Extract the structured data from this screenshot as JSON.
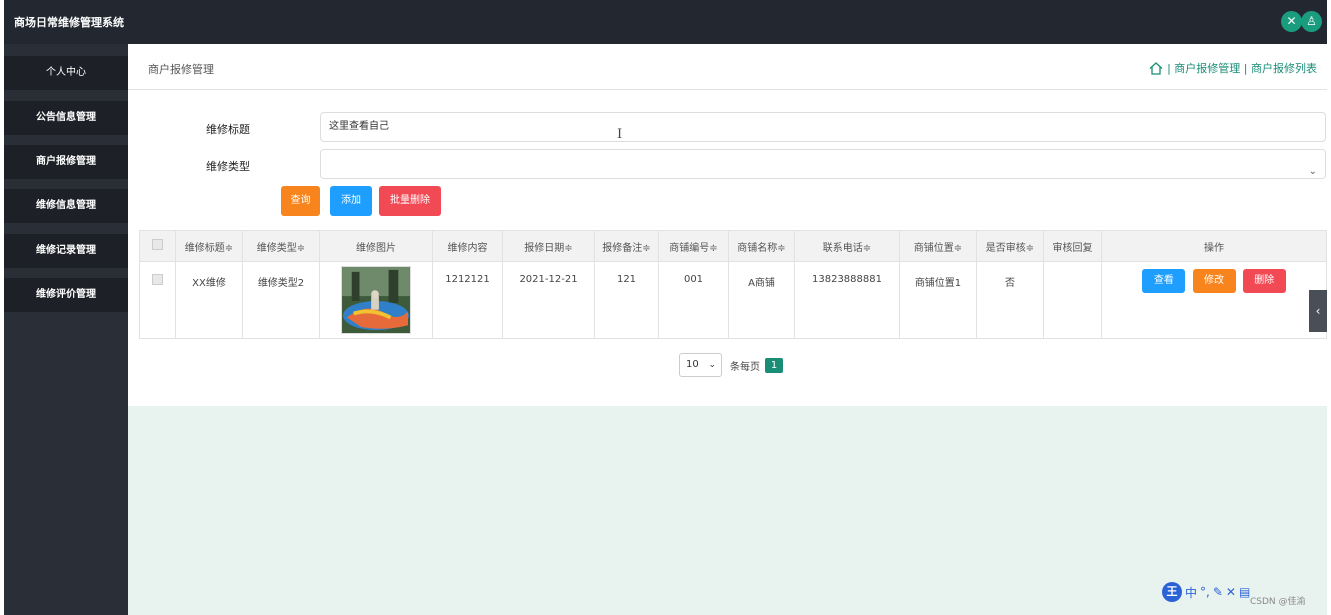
{
  "app": {
    "title": "商场日常维修管理系统"
  },
  "topbar": {
    "icon1": "expand-icon",
    "icon2": "user-icon"
  },
  "sidebar": {
    "items": [
      {
        "label": "个人中心"
      },
      {
        "label": "公告信息管理"
      },
      {
        "label": "商户报修管理"
      },
      {
        "label": "维修信息管理"
      },
      {
        "label": "维修记录管理"
      },
      {
        "label": "维修评价管理"
      }
    ]
  },
  "page": {
    "title": "商户报修管理",
    "breadcrumb": "| 商户报修管理 | 商户报修列表"
  },
  "search": {
    "title_label": "维修标题",
    "title_value": "这里查看自己",
    "type_label": "维修类型",
    "type_value": ""
  },
  "buttons": {
    "query": "查询",
    "add": "添加",
    "batch_delete": "批量删除"
  },
  "table": {
    "headers": [
      "维修标题≑",
      "维修类型≑",
      "维修图片",
      "维修内容",
      "报修日期≑",
      "报修备注≑",
      "商铺编号≑",
      "商铺名称≑",
      "联系电话≑",
      "商铺位置≑",
      "是否审核≑",
      "审核回复",
      "操作"
    ],
    "rows": [
      {
        "title": "XX维修",
        "type": "维修类型2",
        "content": "1212121",
        "date": "2021-12-21",
        "remark": "121",
        "shop_no": "001",
        "shop_name": "A商铺",
        "phone": "13823888881",
        "location": "商铺位置1",
        "audited": "否",
        "reply": ""
      }
    ],
    "ops": {
      "view": "查看",
      "edit": "修改",
      "delete": "删除"
    }
  },
  "pager": {
    "size": "10",
    "per_page": "条每页",
    "page": "1"
  },
  "ime": {
    "logo": "王",
    "c1": "中",
    "c2": "°,",
    "c3": "✎",
    "c4": "✕",
    "c5": "▤"
  },
  "watermark": "CSDN @佳渝",
  "colors": {
    "accent": "#1a8d77",
    "query": "#f7841d",
    "add": "#1e9fff",
    "delete": "#f24a55",
    "view": "#1e9fff",
    "edit": "#f7841d"
  }
}
